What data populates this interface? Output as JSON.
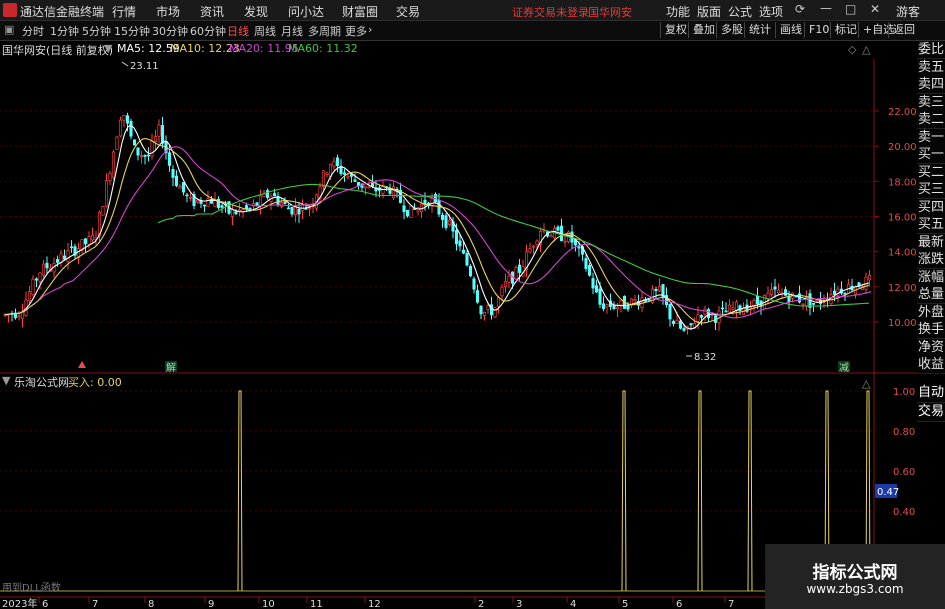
{
  "menubar": {
    "app_title": "通达信金融终端",
    "items": [
      "行情",
      "市场",
      "资讯",
      "发现",
      "问小达",
      "财富圈",
      "交易"
    ],
    "warning": "证券交易未登录",
    "stock_name": "国华网安",
    "right_items": [
      "功能",
      "版面",
      "公式",
      "选项"
    ],
    "user": "游客"
  },
  "toolbar": {
    "periods": [
      "分时",
      "1分钟",
      "5分钟",
      "15分钟",
      "30分钟",
      "60分钟",
      "日线",
      "周线",
      "月线",
      "多周期",
      "更多"
    ],
    "active_period": "日线",
    "buttons": [
      "复权",
      "叠加",
      "多股",
      "统计",
      "画线",
      "F10",
      "标记",
      "+自选",
      "返回"
    ]
  },
  "info": {
    "title": "国华网安(日线 前复权)",
    "ma": [
      {
        "label": "MA5: 12.59",
        "color": "#ffffff"
      },
      {
        "label": "MA10: 12.23",
        "color": "#e8d35c"
      },
      {
        "label": "MA20: 11.95",
        "color": "#d542d5"
      },
      {
        "label": "MA60: 11.32",
        "color": "#3fc73f"
      }
    ]
  },
  "main_axis": [
    "22.00",
    "20.00",
    "18.00",
    "16.00",
    "14.00",
    "12.00",
    "10.00"
  ],
  "annotations": {
    "high": "23.11",
    "low": "8.32",
    "jie": "解",
    "jian": "减"
  },
  "indicator": {
    "title": "乐淘公式网",
    "buy": "买入: 0.00",
    "axis": [
      "1.00",
      "0.80",
      "0.60",
      "0.40"
    ],
    "current": "0.47",
    "footnote": "用到DLL函数"
  },
  "xaxis": {
    "year": "2023年",
    "months": [
      "6",
      "7",
      "8",
      "9",
      "10",
      "11",
      "12",
      "2",
      "3",
      "4",
      "5",
      "6",
      "7"
    ]
  },
  "side_panel": [
    "委比",
    "卖五",
    "卖四",
    "卖三",
    "卖二",
    "卖一",
    "买一",
    "买二",
    "买三",
    "买四",
    "买五",
    "最新",
    "涨跌",
    "涨幅",
    "总量",
    "外盘",
    "换手",
    "净资",
    "收益"
  ],
  "side_panel2": [
    "自动",
    "交易"
  ],
  "watermark": {
    "line1": "指标公式网",
    "line2": "www.zbgs3.com"
  },
  "colors": {
    "up": "#ff3c3c",
    "down": "#55ffff",
    "ma5": "#ffffff",
    "ma10": "#e8d35c",
    "ma20": "#d542d5",
    "ma60": "#3fc73f",
    "grid": "#5a0000",
    "spike": "#e8d35c"
  }
}
